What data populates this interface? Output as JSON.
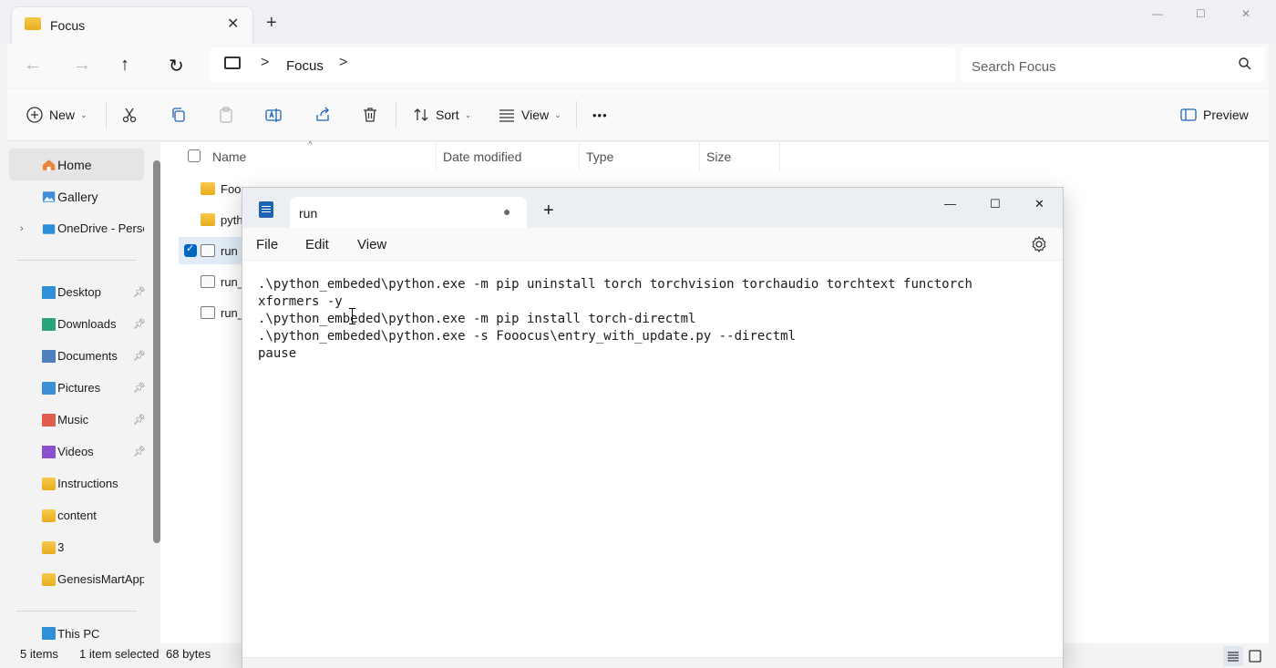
{
  "explorer": {
    "tab_title": "Focus",
    "tab_close": "✕",
    "new_tab": "+",
    "window_controls": {
      "minimize": "—",
      "maximize": "☐",
      "close": "✕"
    },
    "nav": {
      "back": "←",
      "forward": "→",
      "up": "↑",
      "refresh": "↻"
    },
    "breadcrumb": {
      "separator": ">",
      "folder": "Focus"
    },
    "search_placeholder": "Search Focus",
    "commands": {
      "new": "New",
      "sort": "Sort",
      "view": "View",
      "more": "•••",
      "preview": "Preview"
    },
    "sidebar": {
      "home": "Home",
      "gallery": "Gallery",
      "onedrive": "OneDrive - Perso",
      "pinned": [
        {
          "label": "Desktop",
          "icon": "desktop-icon",
          "color": "#2f8fd8"
        },
        {
          "label": "Downloads",
          "icon": "downloads-icon",
          "color": "#2aa37a"
        },
        {
          "label": "Documents",
          "icon": "documents-icon",
          "color": "#4e7fbf"
        },
        {
          "label": "Pictures",
          "icon": "pictures-icon",
          "color": "#3c8fd6"
        },
        {
          "label": "Music",
          "icon": "music-icon",
          "color": "#e05c4f"
        },
        {
          "label": "Videos",
          "icon": "videos-icon",
          "color": "#8a4fcf"
        }
      ],
      "folders": [
        "Instructions",
        "content",
        "3",
        "GenesisMartApp"
      ],
      "this_pc": "This PC"
    },
    "columns": {
      "name": "Name",
      "date_modified": "Date modified",
      "type": "Type",
      "size": "Size"
    },
    "files": [
      {
        "name": "Fooo",
        "kind": "folder"
      },
      {
        "name": "pyth",
        "kind": "folder"
      },
      {
        "name": "run",
        "kind": "batch",
        "selected": true
      },
      {
        "name": "run_",
        "kind": "batch"
      },
      {
        "name": "run_",
        "kind": "batch"
      }
    ],
    "status": {
      "items": "5 items",
      "selected": "1 item selected",
      "size": "68 bytes"
    }
  },
  "notepad": {
    "tab_title": "run",
    "unsaved_dot": "●",
    "new_tab": "+",
    "window_controls": {
      "minimize": "—",
      "maximize": "☐",
      "close": "✕"
    },
    "menu": {
      "file": "File",
      "edit": "Edit",
      "view": "View"
    },
    "lines": [
      ".\\python_embeded\\python.exe -m pip uninstall torch torchvision torchaudio torchtext functorch",
      "xformers -y",
      ".\\python_embeded\\python.exe -m pip install torch-directml",
      ".\\python_embeded\\python.exe -s Fooocus\\entry_with_update.py --directml",
      "pause"
    ]
  },
  "colors": {
    "accent": "#0067c0",
    "folder": "#f2bd3a"
  }
}
